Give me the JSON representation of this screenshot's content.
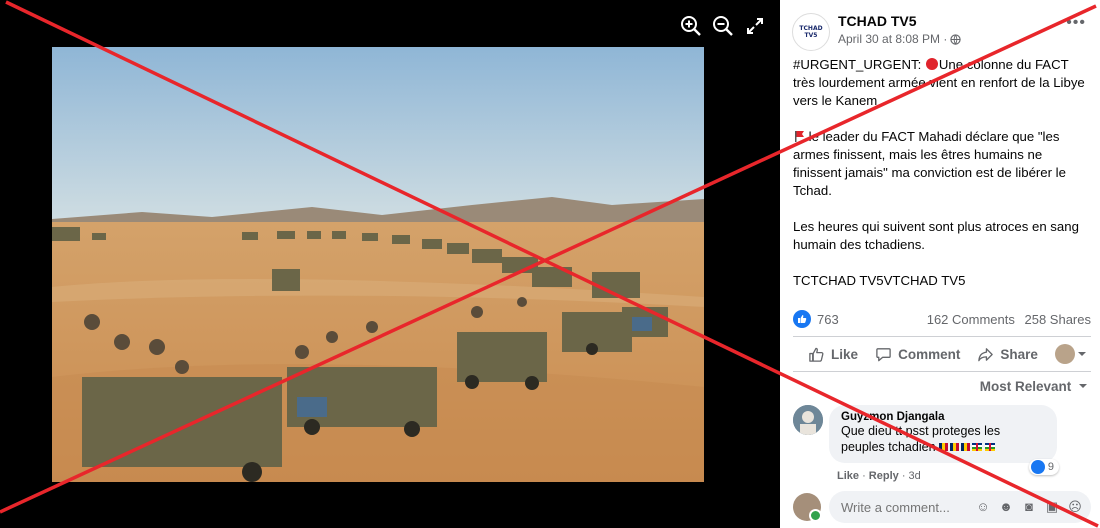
{
  "viewer": {
    "icons": [
      "zoom-in-icon",
      "zoom-out-icon",
      "expand-icon"
    ]
  },
  "post": {
    "page_name": "TCHAD TV5",
    "avatar_text": "TCHAD TV5",
    "date": "April 30 at 8:08 PM · ",
    "privacy_icon": "globe-icon",
    "more_label": "•••",
    "text_p1_a": "#URGENT_URGENT: ",
    "text_p1_b": "Une colonne du FACT très lourdement armée vient en renfort de la Libye vers le Kanem",
    "text_p2": "le leader du FACT Mahadi déclare que \"les armes finissent, mais les êtres humains ne finissent jamais\" ma conviction est de libérer le Tchad.",
    "text_p3": "Les heures qui suivent sont plus atroces en sang humain des tchadiens.",
    "text_p4": "TCTCHAD TV5VTCHAD TV5"
  },
  "stats": {
    "likes": "763",
    "comments": "162 Comments",
    "shares": "258 Shares"
  },
  "actions": {
    "like": "Like",
    "comment": "Comment",
    "share": "Share"
  },
  "sort_label": "Most Relevant",
  "comment": {
    "author": "Guyzmon Djangala",
    "text": "Que dieu tt psst proteges les peuples tchadien",
    "reaction_count": "9",
    "like": "Like",
    "reply": "Reply",
    "time": "3d"
  },
  "composer": {
    "placeholder": "Write a comment..."
  },
  "colors": {
    "cross": "#e8262b",
    "accent": "#1877f2"
  }
}
